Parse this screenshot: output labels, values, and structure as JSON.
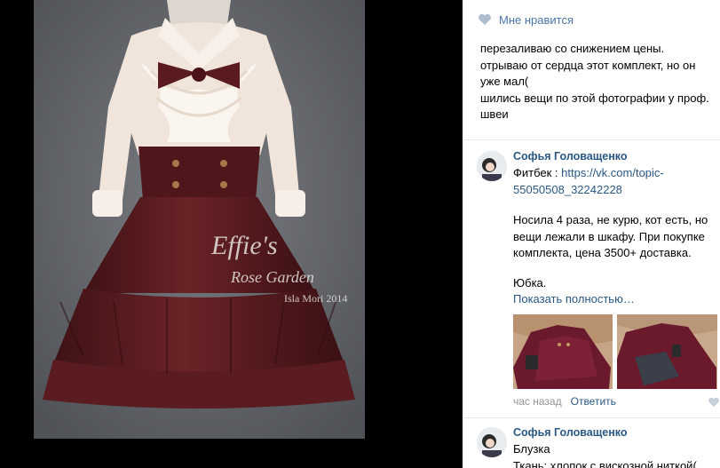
{
  "photo": {
    "watermark_line1": "Effie's",
    "watermark_line2": "Rose Garden",
    "watermark_line3": "Isla Mori 2014"
  },
  "likes": {
    "icon": "heart-icon",
    "label": "Мне нравится"
  },
  "description": {
    "lines": [
      "перезаливаю со снижением цены.",
      "отрываю от сердца этот комплект, но он",
      "уже мал(",
      "шились вещи по этой фотографии у проф.",
      "швеи"
    ]
  },
  "comments": [
    {
      "author": "Софья Головащенко",
      "text_prefix": "Фитбек : ",
      "link_line1": "https://vk.com/topic-",
      "link_line2": "55050508_32242228",
      "paragraph": [
        "Носила 4 раза, не курю, кот есть, но",
        "вещи лежали в шкафу. При покупке",
        "комплекта, цена 3500+ доставка."
      ],
      "last_line": "Юбка.",
      "show_more": "Показать полностью…",
      "time": "час назад",
      "reply": "Ответить"
    },
    {
      "author": "Софья Головащенко",
      "line1": "Блузка",
      "line2": "Ткань: хлопок с вискозной ниткой("
    }
  ],
  "colors": {
    "link": "#2a5885",
    "like": "#4a76a8",
    "heart": "#aebed1",
    "skirt": "#5c1d20",
    "blouse": "#f1e4da"
  }
}
